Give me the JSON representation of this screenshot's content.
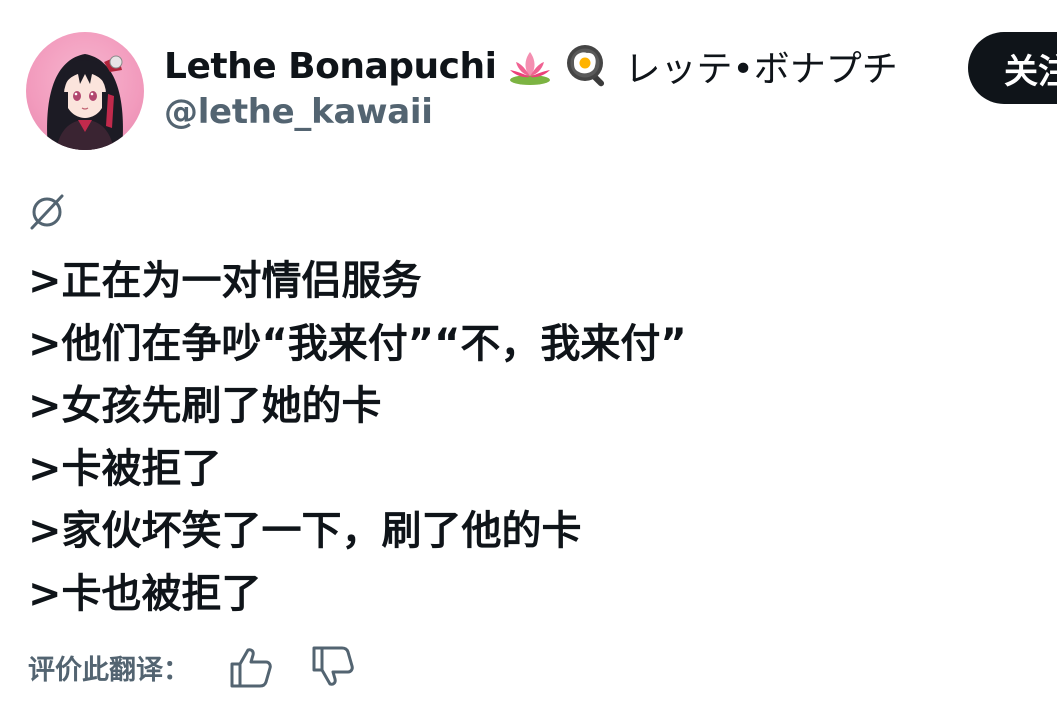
{
  "author": {
    "display_name": "Lethe Bonapuchi",
    "emojis": [
      "lotus-emoji",
      "fried-egg-pan-emoji"
    ],
    "japanese_name": "レッテ•ボナプチ",
    "handle": "@lethe_kawaii",
    "avatar": "anime-girl-avatar"
  },
  "follow_button": {
    "label": "关注"
  },
  "tweet": {
    "status_icon": "empty-set-icon",
    "lines": [
      ">正在为一对情侣服务",
      ">他们在争吵“我来付”“不，我来付”",
      ">女孩先刷了她的卡",
      ">卡被拒了",
      ">家伙坏笑了一下，刷了他的卡",
      ">卡也被拒了"
    ]
  },
  "translation_rating": {
    "label": "评价此翻译：",
    "icons": [
      "thumbs-up-icon",
      "thumbs-down-icon"
    ]
  },
  "colors": {
    "text_primary": "#0f1419",
    "text_secondary": "#536471",
    "button_bg": "#0f1419",
    "button_text": "#ffffff"
  }
}
